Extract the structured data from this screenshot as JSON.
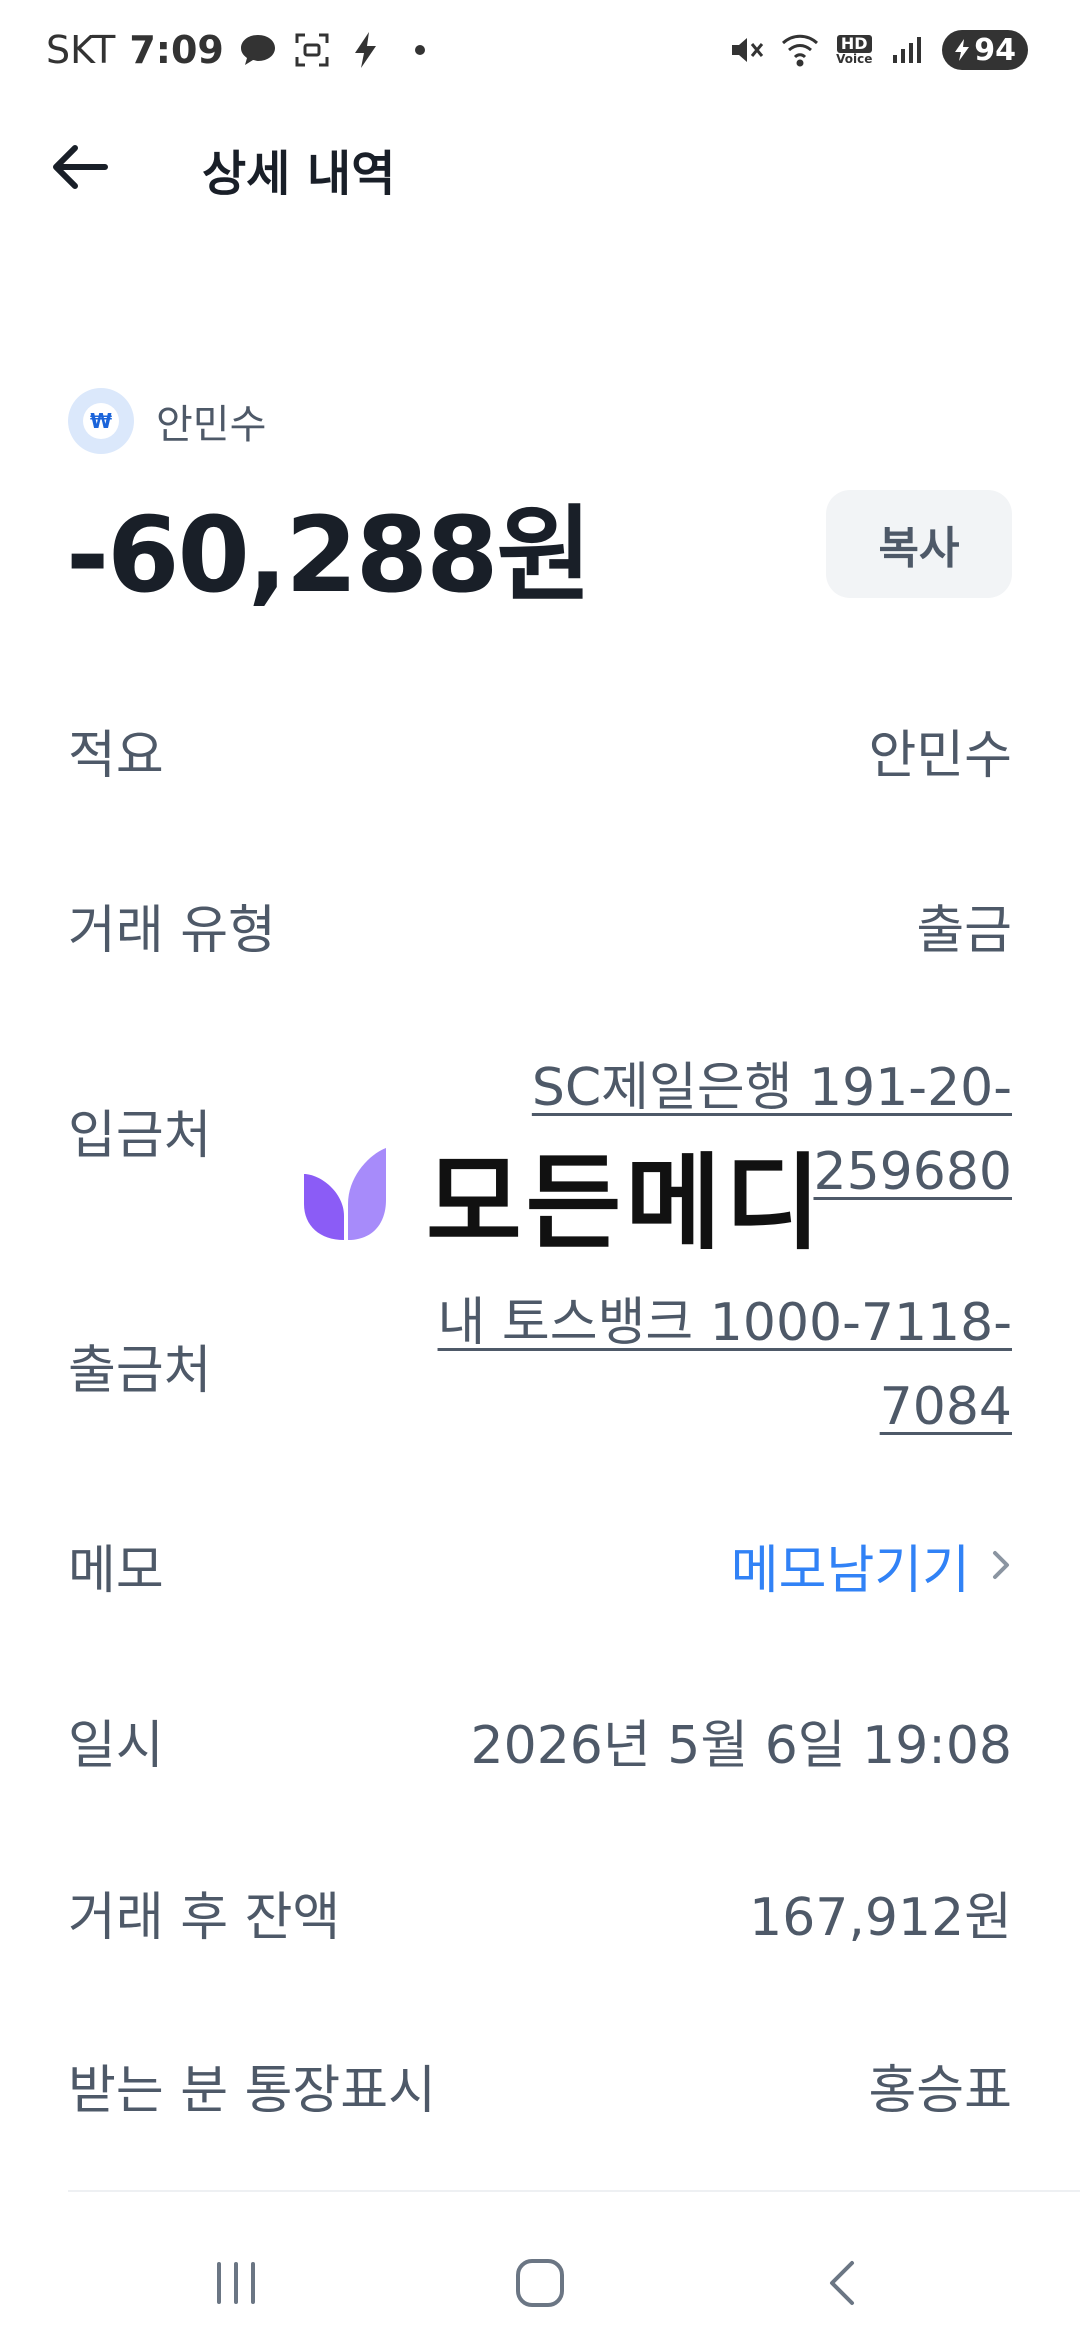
{
  "status_bar": {
    "carrier": "SKT",
    "time": "7:09",
    "battery": "94",
    "hd_label": "HD",
    "voice_label": "Voice"
  },
  "header": {
    "title": "상세 내역"
  },
  "summary": {
    "account_name": "안민수",
    "amount": "-60,288원",
    "copy_label": "복사",
    "logo_glyph": "₩"
  },
  "details": [
    {
      "label": "적요",
      "value": "안민수"
    },
    {
      "label": "거래 유형",
      "value": "출금"
    },
    {
      "label": "입금처",
      "value": "SC제일은행 191-20-259680"
    },
    {
      "label": "출금처",
      "value": "내 토스뱅크 1000-7118-7084"
    },
    {
      "label": "메모",
      "value": "메모남기기"
    },
    {
      "label": "일시",
      "value": "2026년 5월 6일 19:08"
    },
    {
      "label": "거래 후 잔액",
      "value": "167,912원"
    },
    {
      "label": "받는 분 통장표시",
      "value": "홍승표"
    }
  ],
  "watermark": {
    "text": "모든메디"
  },
  "colors": {
    "accent_blue": "#3182f6",
    "text_primary": "#191f28",
    "text_secondary": "#4e5968",
    "button_bg": "#f2f4f6",
    "watermark_purple": "#8b5cf6"
  }
}
